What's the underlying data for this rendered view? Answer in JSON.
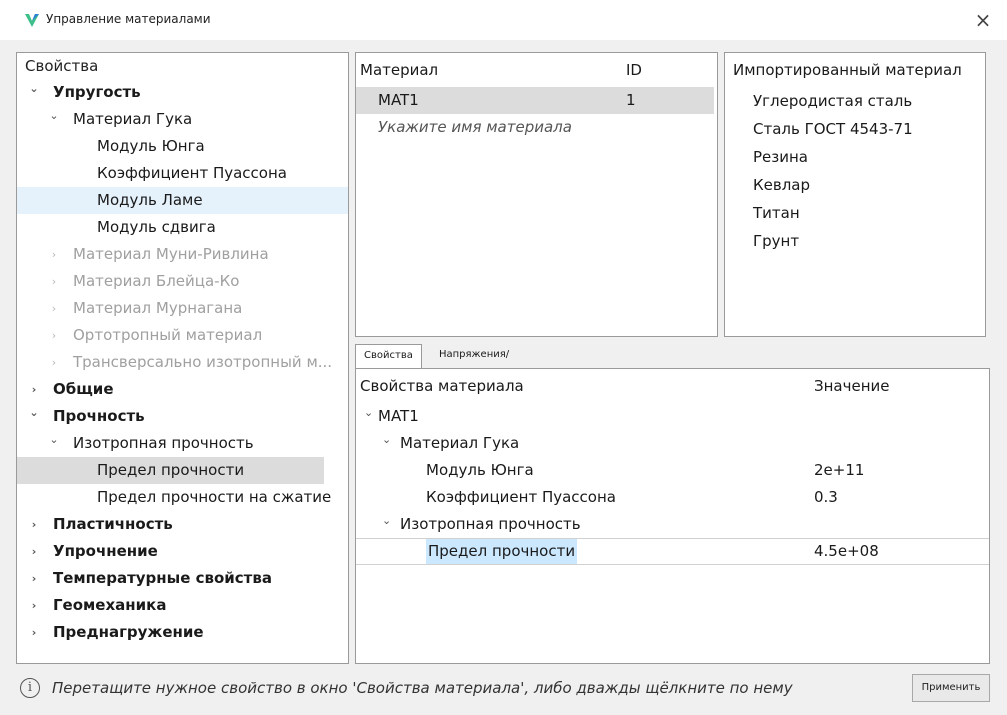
{
  "window": {
    "title": "Управление материалами",
    "close_glyph": "×",
    "icon": "app-logo-icon"
  },
  "tree": {
    "header": "Свойства",
    "items": [
      {
        "label": "Упругость",
        "level": 0,
        "expanded": true,
        "bold": true
      },
      {
        "label": "Материал Гука",
        "level": 1,
        "expanded": true
      },
      {
        "label": "Модуль Юнга",
        "level": 2
      },
      {
        "label": "Коэффициент Пуассона",
        "level": 2
      },
      {
        "label": "Модуль Ламе",
        "level": 2,
        "selected": true
      },
      {
        "label": "Модуль сдвига",
        "level": 2
      },
      {
        "label": "Материал Муни-Ривлина",
        "level": 1,
        "expanded": false,
        "disabled": true
      },
      {
        "label": "Материал Блейца-Ко",
        "level": 1,
        "expanded": false,
        "disabled": true
      },
      {
        "label": "Материал Мурнагана",
        "level": 1,
        "expanded": false,
        "disabled": true
      },
      {
        "label": "Ортотропный материал",
        "level": 1,
        "expanded": false,
        "disabled": true
      },
      {
        "label": "Трансверсально изотропный м...",
        "level": 1,
        "expanded": false,
        "disabled": true
      },
      {
        "label": "Общие",
        "level": 0,
        "expanded": false,
        "bold": true
      },
      {
        "label": "Прочность",
        "level": 0,
        "expanded": true,
        "bold": true
      },
      {
        "label": "Изотропная прочность",
        "level": 1,
        "expanded": true
      },
      {
        "label": "Предел прочности",
        "level": 2,
        "highlighted": true
      },
      {
        "label": "Предел прочности на сжатие",
        "level": 2
      },
      {
        "label": "Пластичность",
        "level": 0,
        "expanded": false,
        "bold": true
      },
      {
        "label": "Упрочнение",
        "level": 0,
        "expanded": false,
        "bold": true
      },
      {
        "label": "Температурные свойства",
        "level": 0,
        "expanded": false,
        "bold": true
      },
      {
        "label": "Геомеханика",
        "level": 0,
        "expanded": false,
        "bold": true
      },
      {
        "label": "Преднагружение",
        "level": 0,
        "expanded": false,
        "bold": true
      }
    ]
  },
  "materials": {
    "col_material": "Материал",
    "col_id": "ID",
    "rows": [
      {
        "name": "MAT1",
        "id": "1",
        "selected": true
      }
    ],
    "placeholder": "Укажите имя материала"
  },
  "imported": {
    "header": "Импортированный материал",
    "items": [
      "Углеродистая сталь",
      "Сталь ГОСТ 4543-71",
      "Резина",
      "Кевлар",
      "Титан",
      "Грунт"
    ]
  },
  "tabs": [
    {
      "label": "Свойства",
      "active": true
    },
    {
      "label": "Напряжения/деформации",
      "active": false
    }
  ],
  "properties": {
    "col_name": "Свойства материала",
    "col_value": "Значение",
    "rows": [
      {
        "label": "MAT1",
        "level": 0,
        "expanded": true,
        "value": ""
      },
      {
        "label": "Материал Гука",
        "level": 1,
        "expanded": true,
        "value": ""
      },
      {
        "label": "Модуль Юнга",
        "level": 2,
        "value": "2e+11"
      },
      {
        "label": "Коэффициент Пуассона",
        "level": 2,
        "value": "0.3"
      },
      {
        "label": "Изотропная прочность",
        "level": 1,
        "expanded": true,
        "value": ""
      },
      {
        "label": "Предел прочности",
        "level": 2,
        "value": "4.5e+08",
        "selected": true
      }
    ]
  },
  "status": {
    "icon": "info-icon",
    "info_glyph": "i",
    "text": "Перетащите нужное свойство в окно 'Свойства материала', либо дважды щёлкните по нему",
    "apply_label": "Применить"
  },
  "colors": {
    "logo_green": "#3dbf8a",
    "logo_blue": "#2b7fd4",
    "selection_light": "#e5f1fb",
    "selection_gray": "#dcdcdc",
    "selection_blue": "#cce8ff"
  }
}
